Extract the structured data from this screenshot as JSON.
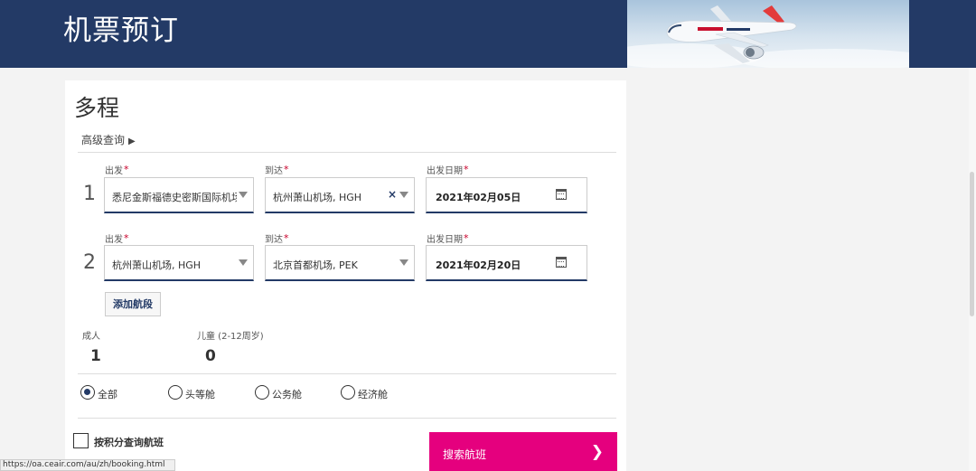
{
  "header": {
    "title": "机票预订"
  },
  "form": {
    "section_title": "多程",
    "advanced_search": "高级查询",
    "advanced_icon": "triangle-right-icon",
    "segments": [
      {
        "number": "1",
        "origin_label": "出发",
        "origin_value": "悉尼金斯福德史密斯国际机场",
        "destination_label": "到达",
        "destination_value": "杭州萧山机场, HGH",
        "date_label": "出发日期",
        "date_value": "2021年02月05日"
      },
      {
        "number": "2",
        "origin_label": "出发",
        "origin_value": "杭州萧山机场, HGH",
        "destination_label": "到达",
        "destination_value": "北京首都机场, PEK",
        "date_label": "出发日期",
        "date_value": "2021年02月20日"
      }
    ],
    "required_mark": "*",
    "clear_mark": "×",
    "add_segment": "添加航段",
    "passengers": {
      "adult_label": "成人",
      "adult_value": "1",
      "child_label": "儿童 (2-12周岁)",
      "child_value": "0"
    },
    "cabin_options": [
      {
        "label": "全部",
        "selected": true
      },
      {
        "label": "头等舱",
        "selected": false
      },
      {
        "label": "公务舱",
        "selected": false
      },
      {
        "label": "经济舱",
        "selected": false
      }
    ],
    "points_checkbox": "按积分查询航班",
    "search_button": "搜索航班",
    "search_chevron": "❯"
  },
  "status_bar": {
    "url": "https://oa.ceair.com/au/zh/booking.html"
  },
  "colors": {
    "header_bg": "#233a66",
    "accent": "#e5007e",
    "required": "#c8002a"
  }
}
